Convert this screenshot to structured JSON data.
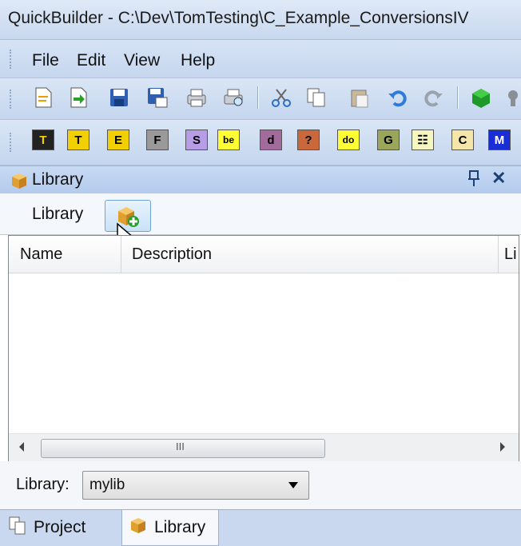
{
  "window": {
    "title": "QuickBuilder - C:\\Dev\\TomTesting\\C_Example_ConversionsIV"
  },
  "menu": {
    "items": [
      "File",
      "Edit",
      "View",
      "Help"
    ]
  },
  "toolbar_standard": {
    "icons": [
      "new-file-icon",
      "open-icon",
      "save-icon",
      "save-all-icon",
      "print-icon",
      "print-preview-icon",
      "cut-icon",
      "copy-icon",
      "paste-icon",
      "undo-icon",
      "redo-icon",
      "build-icon",
      "tools-icon"
    ]
  },
  "toolbar_letters": {
    "buttons": [
      {
        "label": "T",
        "bg": "#222222",
        "fg": "#f2d000",
        "name": "letter-t-black-button"
      },
      {
        "label": "T",
        "bg": "#f2d000",
        "fg": "#000000",
        "name": "letter-t-button"
      },
      {
        "label": "E",
        "bg": "#f2d000",
        "fg": "#000000",
        "name": "letter-e-button"
      },
      {
        "label": "F",
        "bg": "#9a9a9a",
        "fg": "#000000",
        "name": "letter-f-button"
      },
      {
        "label": "S",
        "bg": "#b79de6",
        "fg": "#000000",
        "name": "letter-s-button"
      },
      {
        "label": "be",
        "bg": "#ffff33",
        "fg": "#000000",
        "name": "letter-be-button"
      },
      {
        "label": "d",
        "bg": "#a36a9c",
        "fg": "#000000",
        "name": "letter-d-button"
      },
      {
        "label": "?",
        "bg": "#c9683a",
        "fg": "#000000",
        "name": "letter-question-button"
      },
      {
        "label": "do",
        "bg": "#ffff33",
        "fg": "#000000",
        "name": "letter-do-button"
      },
      {
        "label": "G",
        "bg": "#9aa65a",
        "fg": "#000000",
        "name": "letter-g-button"
      },
      {
        "label": "☷",
        "bg": "#f6f6c0",
        "fg": "#000000",
        "name": "letter-grid-button"
      },
      {
        "label": "C",
        "bg": "#f3e6a8",
        "fg": "#000000",
        "name": "letter-c-button"
      },
      {
        "label": "M",
        "bg": "#1a2ed6",
        "fg": "#ffffff",
        "name": "letter-m-button"
      }
    ]
  },
  "library_panel": {
    "title": "Library",
    "pin_glyph": "ᵖ",
    "close_glyph": "✕",
    "tab_label": "Library",
    "columns": [
      "Name",
      "Description",
      "Li"
    ],
    "scroll_grip": "III",
    "footer_label": "Library:",
    "selected_library": "mylib"
  },
  "bottom_tabs": [
    {
      "label": "Project",
      "active": false
    },
    {
      "label": "Library",
      "active": true
    }
  ],
  "colors": {
    "accent": "#2b579a",
    "panel_header": "#b3cbee"
  }
}
